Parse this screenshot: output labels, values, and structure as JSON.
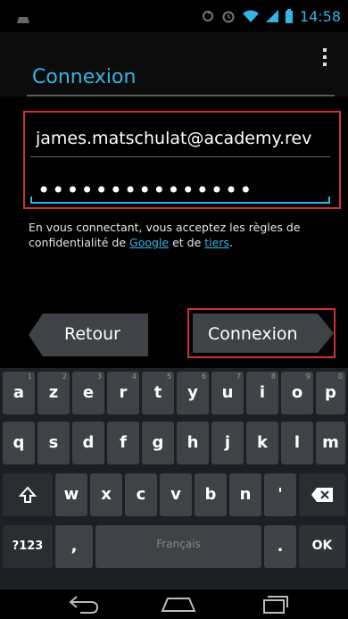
{
  "status_bar": {
    "time": "14:58",
    "icons": [
      "app-notification-icon",
      "sync-icon",
      "alarm-icon",
      "wifi-icon",
      "signal-icon",
      "battery-icon"
    ]
  },
  "app": {
    "title": "Connexion",
    "menu_icon": "overflow-menu-icon"
  },
  "form": {
    "email_value": "james.matschulat@academy.rev",
    "password_mask": "•••••••••••••••"
  },
  "terms": {
    "text_before": "En vous connectant, vous acceptez les règles de confidentialité de ",
    "link_google": "Google",
    "text_middle": " et de ",
    "link_tiers": "tiers",
    "text_after": "."
  },
  "buttons": {
    "back_label": "Retour",
    "next_label": "Connexion"
  },
  "keyboard": {
    "row1": [
      {
        "key": "a",
        "num": "1"
      },
      {
        "key": "z",
        "num": "2"
      },
      {
        "key": "e",
        "num": "3"
      },
      {
        "key": "r",
        "num": "4"
      },
      {
        "key": "t",
        "num": "5"
      },
      {
        "key": "y",
        "num": "6"
      },
      {
        "key": "u",
        "num": "7"
      },
      {
        "key": "i",
        "num": "8"
      },
      {
        "key": "o",
        "num": "9"
      },
      {
        "key": "p",
        "num": "0"
      }
    ],
    "row2": [
      "q",
      "s",
      "d",
      "f",
      "g",
      "h",
      "j",
      "k",
      "l",
      "m"
    ],
    "row3": [
      "w",
      "x",
      "c",
      "v",
      "b",
      "n",
      "'"
    ],
    "symbols_label": "?123",
    "comma_label": ",",
    "space_label": "Français",
    "period_label": ".",
    "ok_label": "OK"
  },
  "colors": {
    "accent": "#33b5e5",
    "highlight": "#cc3333",
    "key_bg": "#3f4246",
    "keyboard_bg": "#1c1f23"
  }
}
